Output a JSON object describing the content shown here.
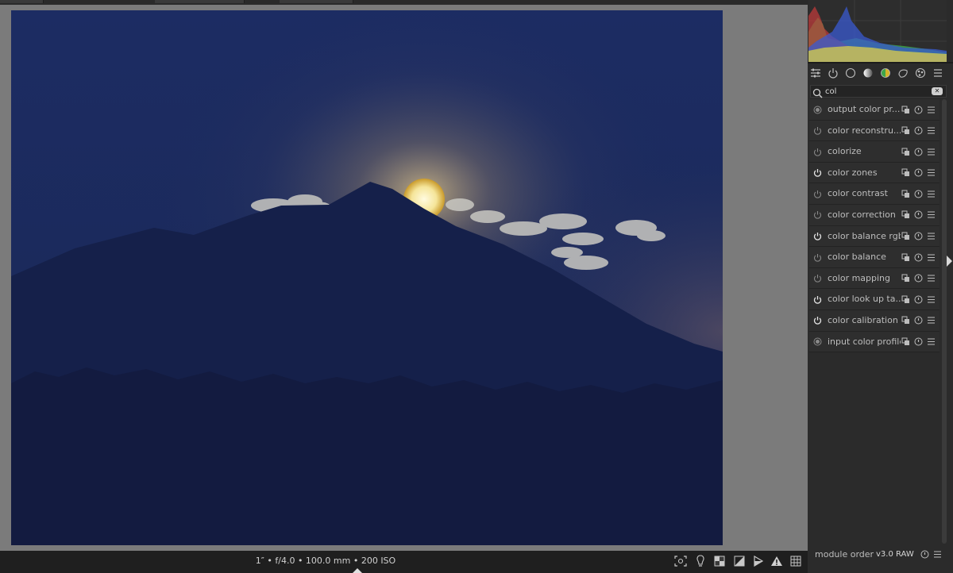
{
  "image": {
    "exif": "1″ • f/4.0 • 100.0 mm • 200 ISO"
  },
  "bottom_toolbar": {
    "icons": [
      "focus-peaking-icon",
      "color-assessment-icon",
      "raw-overexposed-icon",
      "clipping-indicator-icon",
      "softproof-icon",
      "gamut-check-icon",
      "guides-icon"
    ]
  },
  "right_panel": {
    "module_group_icons": [
      "presets-icon",
      "active-modules-icon",
      "base-group-icon",
      "tone-group-icon",
      "color-group-icon",
      "correct-group-icon",
      "effect-group-icon",
      "menu-icon"
    ],
    "search": {
      "value": "col",
      "clear_label": "✕"
    },
    "modules": [
      {
        "label": "output color pr...",
        "state": "always-on"
      },
      {
        "label": "color reconstru...",
        "state": "off"
      },
      {
        "label": "colorize",
        "state": "off"
      },
      {
        "label": "color zones",
        "state": "on"
      },
      {
        "label": "color contrast",
        "state": "off"
      },
      {
        "label": "color correction",
        "state": "off"
      },
      {
        "label": "color balance rgb",
        "state": "on"
      },
      {
        "label": "color balance",
        "state": "off"
      },
      {
        "label": "color mapping",
        "state": "off"
      },
      {
        "label": "color look up ta...",
        "state": "on"
      },
      {
        "label": "color calibration",
        "state": "on"
      },
      {
        "label": "input color profile",
        "state": "always-on"
      }
    ],
    "footer": {
      "module_order_label": "module order",
      "version": "v3.0 RAW"
    }
  },
  "colors": {
    "panel_bg": "#2b2b2b",
    "module_bg": "#2e2e2e",
    "text": "#bdbdbd",
    "active_power": "#e6e6e6",
    "inactive_power": "#8a8a8a",
    "photo_sky": "#1a2a5e"
  }
}
